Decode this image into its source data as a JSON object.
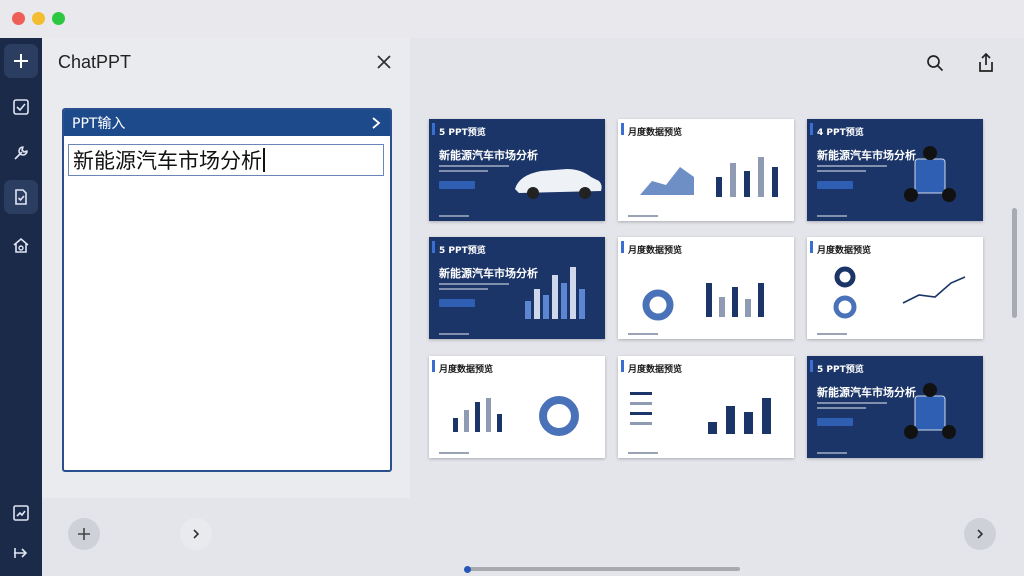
{
  "window": {
    "traffic_lights": [
      "#ee5f57",
      "#f4bc2f",
      "#2dc742"
    ]
  },
  "rail": {
    "items": [
      {
        "icon": "plus-icon"
      },
      {
        "icon": "checkbox-icon"
      },
      {
        "icon": "wrench-icon"
      },
      {
        "icon": "document-check-icon",
        "active": true
      },
      {
        "icon": "home-gear-icon"
      },
      {
        "icon": "chart-icon"
      },
      {
        "icon": "export-icon"
      }
    ]
  },
  "chat": {
    "title": "ChatPPT",
    "input_header": "PPT输入",
    "input_value": "新能源汽车市场分析"
  },
  "slides": [
    {
      "theme": "dark",
      "label": "5 PPT预览",
      "heading": "新能源汽车市场分析",
      "visual": "car"
    },
    {
      "theme": "light",
      "label": "月度数据预览",
      "visual": "area-bars"
    },
    {
      "theme": "dark",
      "label": "4 PPT预览",
      "heading": "新能源汽车市场分析",
      "visual": "robot"
    },
    {
      "theme": "dark",
      "label": "5 PPT预览",
      "heading": "新能源汽车市场分析",
      "visual": "bars"
    },
    {
      "theme": "light",
      "label": "月度数据预览",
      "visual": "donut-bars"
    },
    {
      "theme": "light",
      "label": "月度数据预览",
      "visual": "donuts-line"
    },
    {
      "theme": "light",
      "label": "月度数据预览",
      "visual": "bars-donut"
    },
    {
      "theme": "light",
      "label": "月度数据预览",
      "visual": "legend-bars"
    },
    {
      "theme": "dark",
      "label": "5 PPT预览",
      "heading": "新能源汽车市场分析",
      "visual": "robot"
    }
  ],
  "colors": {
    "navy": "#1b3568",
    "accent": "#2f5fb3",
    "rail": "#1c2a4a"
  }
}
